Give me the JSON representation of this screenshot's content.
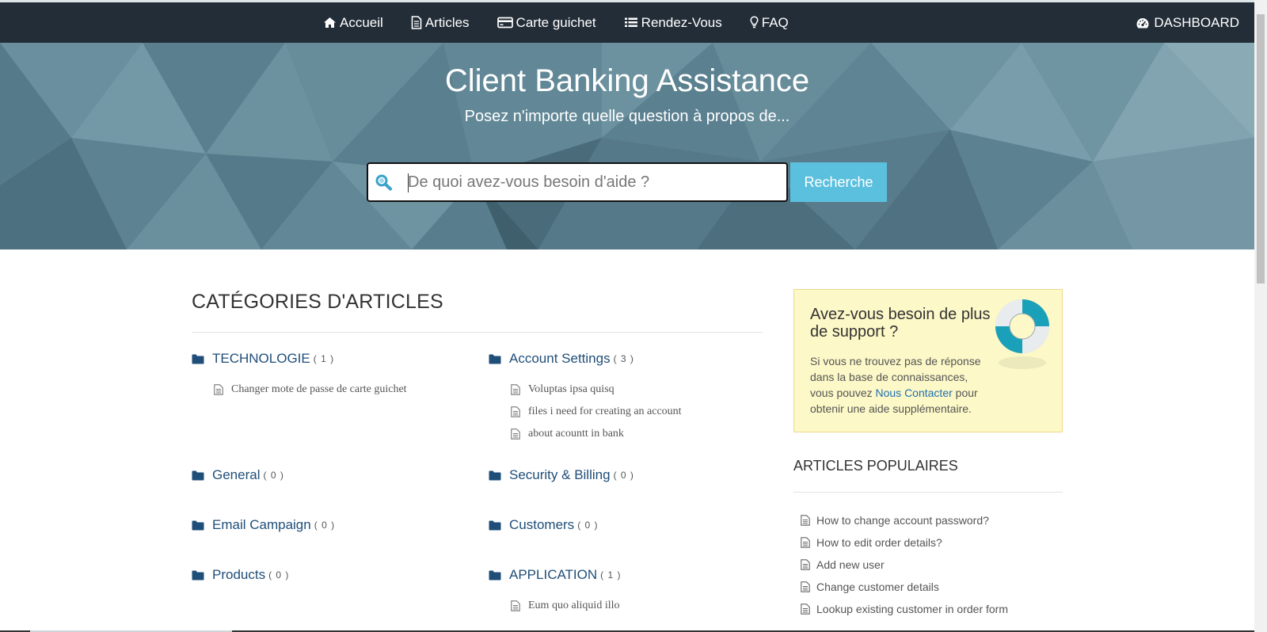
{
  "nav": {
    "items": [
      {
        "label": "Accueil",
        "icon": "home-icon"
      },
      {
        "label": "Articles",
        "icon": "file-icon"
      },
      {
        "label": "Carte guichet",
        "icon": "credit-card-icon"
      },
      {
        "label": "Rendez-Vous",
        "icon": "list-icon"
      },
      {
        "label": "FAQ",
        "icon": "lightbulb-icon"
      }
    ],
    "dashboard": {
      "label": "DASHBOARD",
      "icon": "dashboard-icon"
    }
  },
  "hero": {
    "title": "Client Banking Assistance",
    "subtitle": "Posez n'importe quelle question à propos de...",
    "search_placeholder": "De quoi avez-vous besoin d'aide ?",
    "search_button": "Recherche"
  },
  "main": {
    "section_title": "CATÉGORIES D'ARTICLES",
    "categories": [
      {
        "name": "TECHNOLOGIE",
        "count": "( 1 )",
        "articles": [
          "Changer mote de passe de carte guichet"
        ]
      },
      {
        "name": "Account Settings",
        "count": "( 3 )",
        "articles": [
          "Voluptas ipsa quisq",
          "files i need for creating an account",
          "about acountt in bank"
        ]
      },
      {
        "name": "General",
        "count": "( 0 )",
        "articles": []
      },
      {
        "name": "Security & Billing",
        "count": "( 0 )",
        "articles": []
      },
      {
        "name": "Email Campaign",
        "count": "( 0 )",
        "articles": []
      },
      {
        "name": "Customers",
        "count": "( 0 )",
        "articles": []
      },
      {
        "name": "Products",
        "count": "( 0 )",
        "articles": []
      },
      {
        "name": "APPLICATION",
        "count": "( 1 )",
        "articles": [
          "Eum quo aliquid illo"
        ]
      }
    ]
  },
  "sidebar": {
    "support": {
      "title": "Avez-vous besoin de plus de support ?",
      "text_before": "Si vous ne trouvez pas de réponse dans la base de connaissances, vous pouvez ",
      "link": "Nous Contacter",
      "text_after": " pour obtenir une aide supplémentaire."
    },
    "popular_title": "ARTICLES POPULAIRES",
    "popular": [
      "How to change account password?",
      "How to edit order details?",
      "Add new user",
      "Change customer details",
      "Lookup existing customer in order form"
    ]
  },
  "colors": {
    "navbar": "#232d37",
    "hero": "#5f8695",
    "accent": "#5bc0de",
    "category_link": "#1f4e79",
    "support_bg": "#fcf8c7"
  }
}
